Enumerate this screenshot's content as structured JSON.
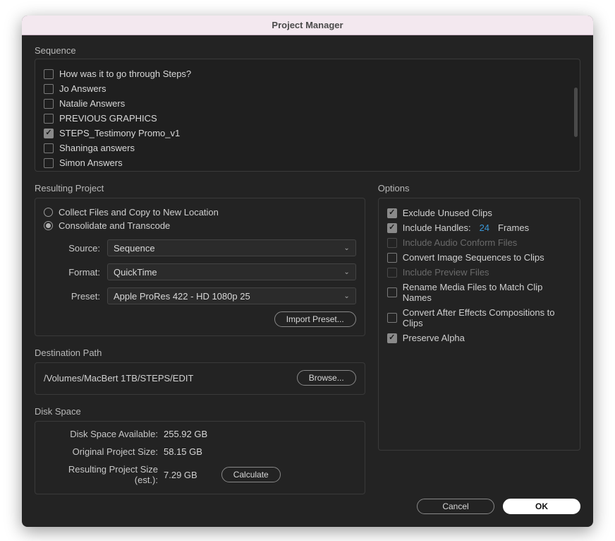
{
  "title": "Project Manager",
  "sequence": {
    "label": "Sequence",
    "items": [
      {
        "label": "How was it to go through Steps?",
        "checked": false
      },
      {
        "label": "Jo Answers",
        "checked": false
      },
      {
        "label": "Natalie Answers",
        "checked": false
      },
      {
        "label": "PREVIOUS GRAPHICS",
        "checked": false
      },
      {
        "label": "STEPS_Testimony Promo_v1",
        "checked": true
      },
      {
        "label": "Shaninga answers",
        "checked": false
      },
      {
        "label": "Simon Answers",
        "checked": false
      }
    ]
  },
  "resulting_project": {
    "label": "Resulting Project",
    "radios": {
      "collect": "Collect Files and Copy to New Location",
      "consolidate": "Consolidate and Transcode",
      "selected": "consolidate"
    },
    "source_label": "Source:",
    "source_value": "Sequence",
    "format_label": "Format:",
    "format_value": "QuickTime",
    "preset_label": "Preset:",
    "preset_value": "Apple ProRes 422 - HD 1080p 25",
    "import_preset": "Import Preset..."
  },
  "destination": {
    "label": "Destination Path",
    "path": "/Volumes/MacBert 1TB/STEPS/EDIT",
    "browse": "Browse..."
  },
  "disk_space": {
    "label": "Disk Space",
    "available_label": "Disk Space Available:",
    "available_value": "255.92 GB",
    "original_label": "Original Project Size:",
    "original_value": "58.15 GB",
    "result_label": "Resulting Project Size (est.):",
    "result_value": "7.29 GB",
    "calculate": "Calculate"
  },
  "options": {
    "label": "Options",
    "items": [
      {
        "label": "Exclude Unused Clips",
        "checked": true,
        "disabled": false
      },
      {
        "label": "Include Handles:",
        "checked": true,
        "disabled": false,
        "value": "24",
        "suffix": "Frames"
      },
      {
        "label": "Include Audio Conform Files",
        "checked": false,
        "disabled": true
      },
      {
        "label": "Convert Image Sequences to Clips",
        "checked": false,
        "disabled": false
      },
      {
        "label": "Include Preview Files",
        "checked": false,
        "disabled": true
      },
      {
        "label": "Rename Media Files to Match Clip Names",
        "checked": false,
        "disabled": false
      },
      {
        "label": "Convert After Effects Compositions to Clips",
        "checked": false,
        "disabled": false
      },
      {
        "label": "Preserve Alpha",
        "checked": true,
        "disabled": false
      }
    ]
  },
  "footer": {
    "cancel": "Cancel",
    "ok": "OK"
  }
}
